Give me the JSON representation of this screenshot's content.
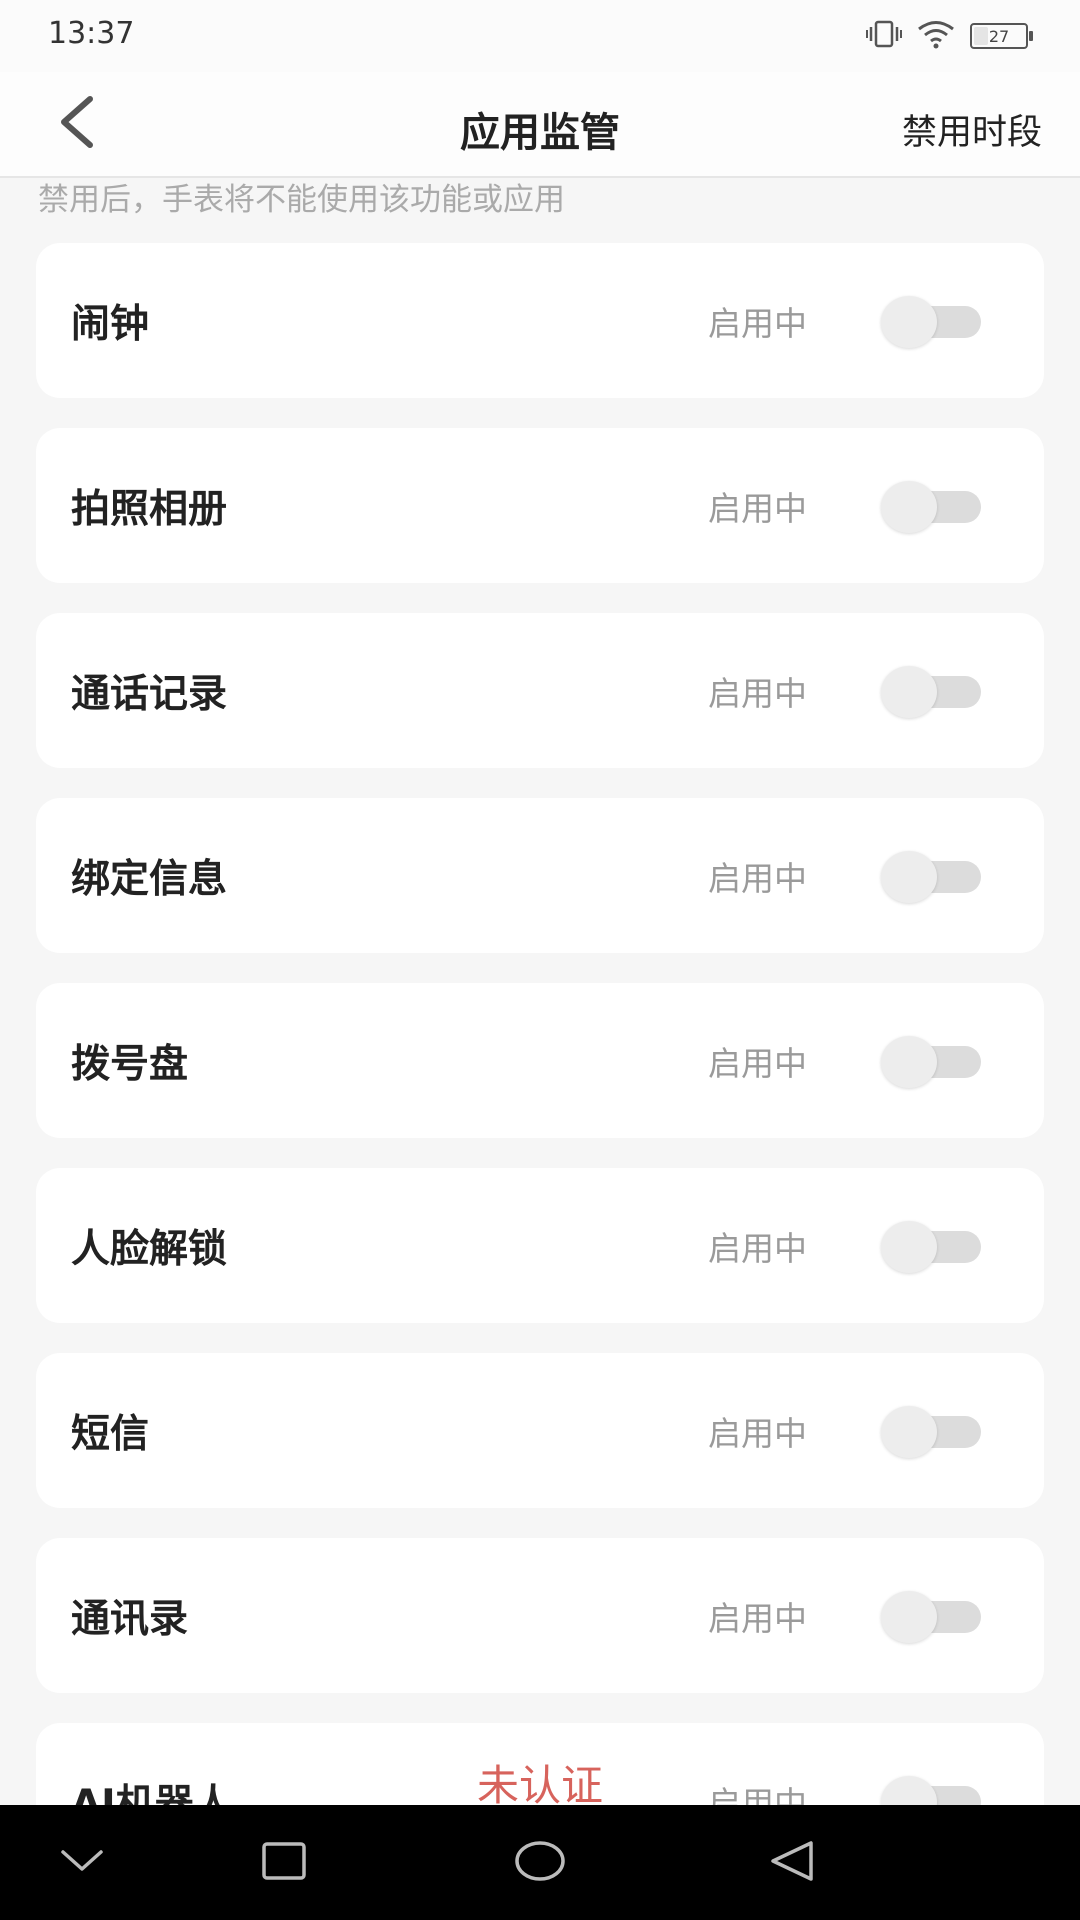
{
  "status_bar": {
    "time": "13:37",
    "battery_level": 27,
    "battery_label": "27",
    "icons": [
      "vibrate-icon",
      "wifi-icon",
      "battery-icon"
    ]
  },
  "header": {
    "title": "应用监管",
    "back_icon": "chevron-left-icon",
    "action_label": "禁用时段"
  },
  "notice": "禁用后，手表将不能使用该功能或应用",
  "apps": [
    {
      "label": "闹钟",
      "status": "启用中",
      "enabled": false
    },
    {
      "label": "拍照相册",
      "status": "启用中",
      "enabled": false
    },
    {
      "label": "通话记录",
      "status": "启用中",
      "enabled": false
    },
    {
      "label": "绑定信息",
      "status": "启用中",
      "enabled": false
    },
    {
      "label": "拨号盘",
      "status": "启用中",
      "enabled": false
    },
    {
      "label": "人脸解锁",
      "status": "启用中",
      "enabled": false
    },
    {
      "label": "短信",
      "status": "启用中",
      "enabled": false
    },
    {
      "label": "通讯录",
      "status": "启用中",
      "enabled": false
    },
    {
      "label": "AI机器人",
      "status": "启用中",
      "enabled": false
    }
  ],
  "watermark": "未认证",
  "nav_bar": {
    "icons": [
      "chevron-down-icon",
      "square-icon",
      "circle-icon",
      "triangle-back-icon"
    ]
  },
  "colors": {
    "background": "#f6f6f6",
    "card": "#ffffff",
    "watermark": "#d7635c",
    "nav_bar": "#000000"
  }
}
